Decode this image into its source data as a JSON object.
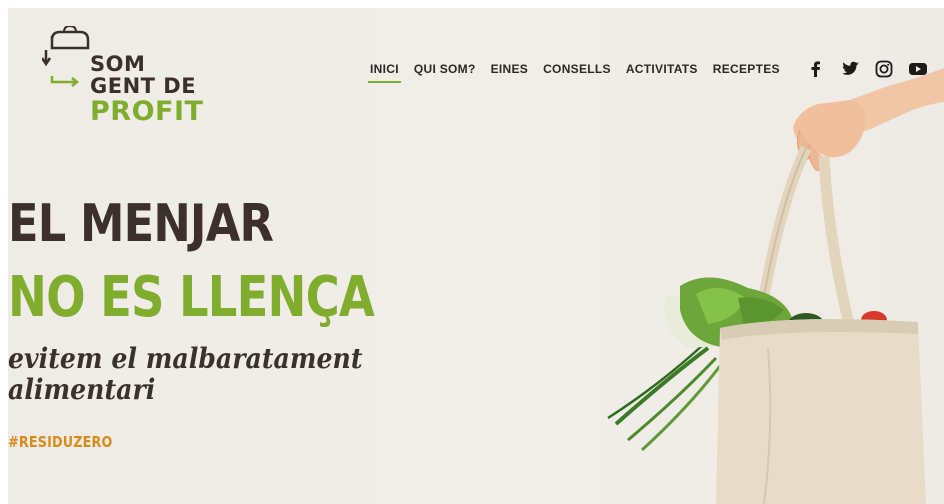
{
  "logo": {
    "line1": "SOM",
    "line2": "GENT DE",
    "line3": "PROFIT"
  },
  "nav": {
    "items": [
      {
        "label": "INICI",
        "active": true
      },
      {
        "label": "QUI SOM?",
        "active": false
      },
      {
        "label": "EINES",
        "active": false
      },
      {
        "label": "CONSELLS",
        "active": false
      },
      {
        "label": "ACTIVITATS",
        "active": false
      },
      {
        "label": "RECEPTES",
        "active": false
      }
    ],
    "social": [
      "facebook-icon",
      "twitter-icon",
      "instagram-icon",
      "youtube-icon"
    ]
  },
  "hero": {
    "headline_line1": "EL MENJAR",
    "headline_line2": "NO ES LLENÇA",
    "subtitle_line1": "evitem el malbaratament",
    "subtitle_line2": "alimentari",
    "hashtag": "#RESIDUZERO"
  },
  "colors": {
    "brand_green": "#7eae2b",
    "dark_brown": "#3b302c",
    "hashtag_orange": "#d88c1a",
    "background": "#f0ede8"
  }
}
